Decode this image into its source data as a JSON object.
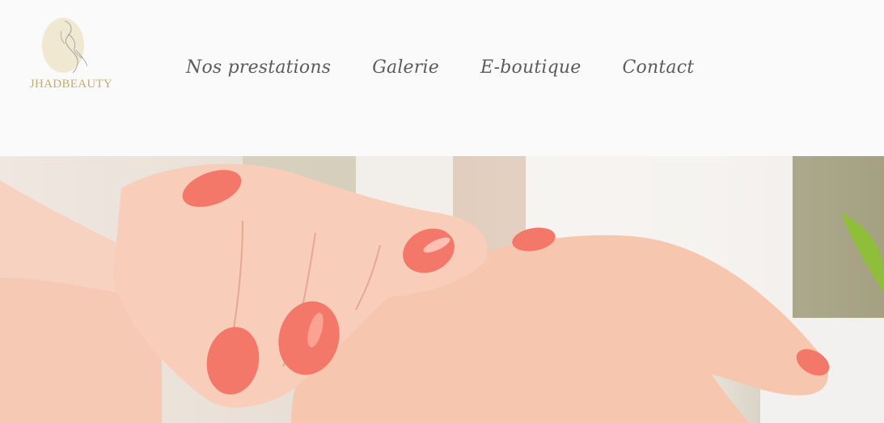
{
  "brand": {
    "name": "JHADBEAUTY",
    "colors": {
      "gold": "#c9a96a",
      "logo_disc": "#f1e8d2"
    }
  },
  "nav": {
    "items": [
      {
        "label": "Nos prestations"
      },
      {
        "label": "Galerie"
      },
      {
        "label": "E-boutique"
      },
      {
        "label": "Contact"
      }
    ],
    "color": "#5c5c5c"
  },
  "hero": {
    "image": "manicured-hands-photo",
    "colors": {
      "nail": "#f4786a",
      "skin": "#f6c4ad"
    }
  }
}
